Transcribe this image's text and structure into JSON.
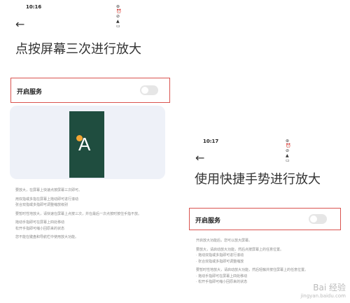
{
  "left": {
    "time": "10:16",
    "status_icons": "⊛ ⏰ ⊘ ▲ ▭",
    "title": "点按屏幕三次进行放大",
    "service_label": "开启服务",
    "preview_letter": "A",
    "description": [
      "要放大，在屏幕上快速点按屏幕三次即可。",
      "用双指或多指在屏幕上拖动即可进行滚动",
      "张合双指或多指即可调整缩放级别",
      "要暂时性地放大，请快速在屏幕上点按三次，并在最后一次点按时按住手指不放。",
      "拖动手指即可在屏幕上四处移动",
      "松开手指即可缩小回原来的状态",
      "您不能在键盘和导航栏中使用放大功能。"
    ]
  },
  "right": {
    "time": "10:17",
    "status_icons": "⊛ ⏰ ⊘ ▲ ▭",
    "title": "使用快捷手势进行放大",
    "service_label": "开启服务",
    "description": [
      "开启放大功能后，您可以放大屏幕。",
      "要放大，请启动放大功能，然后点按屏幕上的任意位置。",
      "· 拖动双指或多指即可进行滚动",
      "· 张合双指或多指即可调整缩放",
      "要暂时性地放大，请启动放大功能，然后轻触并按住屏幕上的任意位置。",
      "· 拖动手指即可在屏幕上四处移动",
      "· 松开手指即可缩小回原来的状态"
    ]
  },
  "watermark": {
    "brand": "Bai 经验",
    "url": "jingyan.baidu.com"
  }
}
